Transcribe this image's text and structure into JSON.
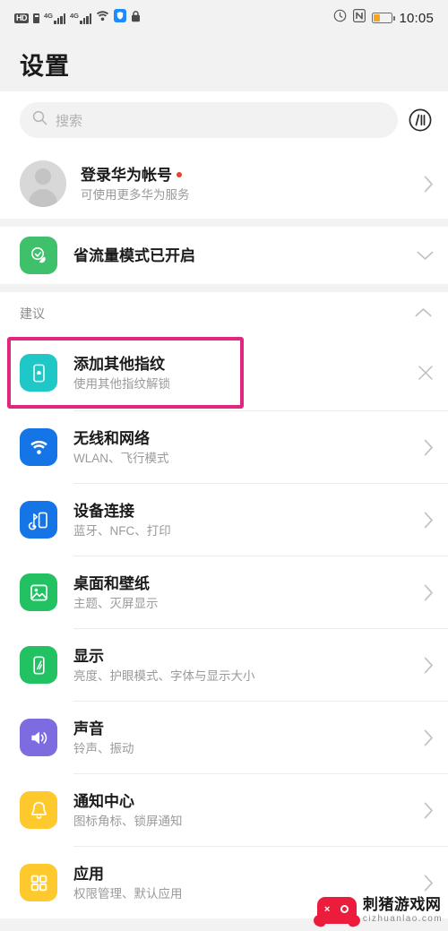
{
  "statusbar": {
    "hd_label": "HD",
    "network_gen_1": "4G",
    "network_gen_2": "4G",
    "icons": [
      "hd-badge",
      "sim-card-icon",
      "signal-4g-icon-1",
      "signal-4g-icon-2",
      "wifi-icon",
      "shield-icon",
      "lock-icon",
      "alarm-icon",
      "nfc-icon",
      "battery-icon"
    ],
    "time": "10:05"
  },
  "header": {
    "title": "设置"
  },
  "search": {
    "placeholder": "搜索",
    "scan_icon": "scan-code-icon"
  },
  "account": {
    "title": "登录华为帐号",
    "subtitle": "可使用更多华为服务",
    "has_badge": true
  },
  "data_saver": {
    "title": "省流量模式已开启",
    "icon": "leaf-data-saver-icon",
    "icon_color": "#3ec16a"
  },
  "suggestion": {
    "section_label": "建议",
    "item": {
      "title": "添加其他指纹",
      "subtitle": "使用其他指纹解锁",
      "icon": "fingerprint-phone-icon",
      "icon_color": "#1fc7c7"
    },
    "highlight_color": "#e2267f"
  },
  "settings_items": [
    {
      "title": "无线和网络",
      "subtitle": "WLAN、飞行模式",
      "icon": "wifi-icon",
      "icon_color": "#1575e6"
    },
    {
      "title": "设备连接",
      "subtitle": "蓝牙、NFC、打印",
      "icon": "device-connection-icon",
      "icon_color": "#1575e6"
    },
    {
      "title": "桌面和壁纸",
      "subtitle": "主题、灭屏显示",
      "icon": "wallpaper-icon",
      "icon_color": "#22c262"
    },
    {
      "title": "显示",
      "subtitle": "亮度、护眼模式、字体与显示大小",
      "icon": "display-icon",
      "icon_color": "#22c262"
    },
    {
      "title": "声音",
      "subtitle": "铃声、振动",
      "icon": "sound-icon",
      "icon_color": "#7c6ce0"
    },
    {
      "title": "通知中心",
      "subtitle": "图标角标、锁屏通知",
      "icon": "bell-icon",
      "icon_color": "#fdc92c"
    },
    {
      "title": "应用",
      "subtitle": "权限管理、默认应用",
      "icon": "apps-grid-icon",
      "icon_color": "#fdc92c"
    }
  ],
  "watermark": {
    "name": "刺猪游戏网",
    "url": "cizhuanlao.com"
  }
}
